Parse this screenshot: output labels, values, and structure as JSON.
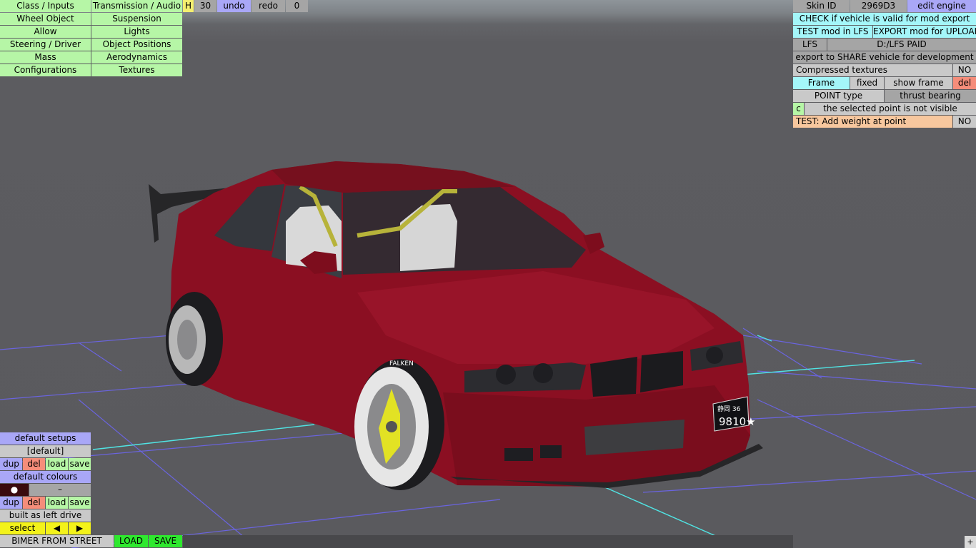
{
  "left_menu": {
    "col1": [
      "Class / Inputs",
      "Wheel Object",
      "Allow",
      "Steering / Driver",
      "Mass",
      "Configurations"
    ],
    "col2": [
      "Transmission / Audio",
      "Suspension",
      "Lights",
      "Object Positions",
      "Aerodynamics",
      "Textures"
    ]
  },
  "toolbar": {
    "h_label": "H",
    "h_value": "30",
    "undo": "undo",
    "redo": "redo",
    "redo_count": "0"
  },
  "right_panel": {
    "skin_id_label": "Skin ID",
    "skin_id_value": "2969D3",
    "edit_engine": "edit engine",
    "check_valid": "CHECK if vehicle is valid for mod export",
    "test_mod": "TEST mod in LFS",
    "export_upload": "EXPORT mod for UPLOAD",
    "lfs_label": "LFS",
    "lfs_path": "D:/LFS PAID",
    "export_share": "export to SHARE vehicle for development",
    "compressed_label": "Compressed textures",
    "compressed_value": "NO",
    "frame_label": "Frame",
    "fixed_label": "fixed",
    "show_frame": "show frame",
    "del": "del",
    "point_type": "POINT type",
    "thrust_bearing": "thrust bearing",
    "c_label": "c",
    "point_status": "the selected point is not visible",
    "add_weight": "TEST: Add weight at point",
    "add_weight_value": "NO"
  },
  "bottom_left": {
    "default_setups": "default setups",
    "setup_value": "[default]",
    "dup": "dup",
    "del": "del",
    "load": "load",
    "save": "save",
    "default_colours": "default colours",
    "colour_dot": "●",
    "colour_dash": "–",
    "built_as": "built as left drive",
    "select": "select",
    "prev_arrow": "◀",
    "next_arrow": "▶"
  },
  "bottom_bar": {
    "vehicle_name": "BIMER FROM STREET",
    "load": "LOAD",
    "save": "SAVE",
    "plus": "+"
  },
  "car": {
    "plate_line1": "静岡 36",
    "plate_line2": "9810★",
    "tyre_brand": "FALKEN",
    "body_color": "#8b0f22",
    "rim_color": "#e2e224"
  },
  "colors": {
    "grid_blue": "#6a64e0",
    "grid_cyan": "#50e4e4"
  }
}
